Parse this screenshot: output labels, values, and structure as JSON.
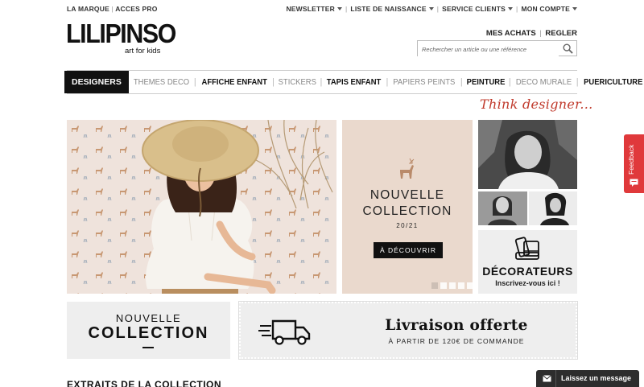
{
  "topbar": {
    "left": [
      "LA MARQUE",
      "ACCES PRO"
    ],
    "right": [
      "NEWSLETTER",
      "LISTE DE NAISSANCE",
      "SERVICE CLIENTS",
      "MON COMPTE"
    ]
  },
  "logo": {
    "brand": "LILIPINSO",
    "tagline": "art for kids"
  },
  "account": {
    "purchases": "MES ACHATS",
    "pay": "REGLER"
  },
  "search": {
    "placeholder": "Rechercher un article ou une référence",
    "value": ""
  },
  "nav": {
    "items": [
      "DESIGNERS",
      "THEMES DECO",
      "AFFICHE ENFANT",
      "STICKERS",
      "TAPIS ENFANT",
      "PAPIERS PEINTS",
      "PEINTURE",
      "DECO MURALE",
      "PUERICULTURE"
    ]
  },
  "think": "Think designer...",
  "slide2": {
    "line1": "NOUVELLE",
    "line2": "COLLECTION",
    "line3": "20/21",
    "button": "À DÉCOUVRIR",
    "accent": "#b98a6a"
  },
  "slider": {
    "dots": 5,
    "active": 1
  },
  "decorateurs": {
    "title": "DÉCORATEURS",
    "sub": "Inscrivez-vous ici !"
  },
  "collection_banner": {
    "line1": "NOUVELLE",
    "line2": "COLLECTION"
  },
  "livraison": {
    "title": "Livraison offerte",
    "sub": "À PARTIR DE 120€ DE COMMANDE"
  },
  "section_title": "EXTRAITS DE LA COLLECTION",
  "feedback": {
    "label": "Feedback",
    "color": "#e0393b"
  },
  "chat": {
    "label": "Laissez un message"
  },
  "colors": {
    "brand_red": "#c0392b",
    "nav_active_bg": "#111111"
  }
}
